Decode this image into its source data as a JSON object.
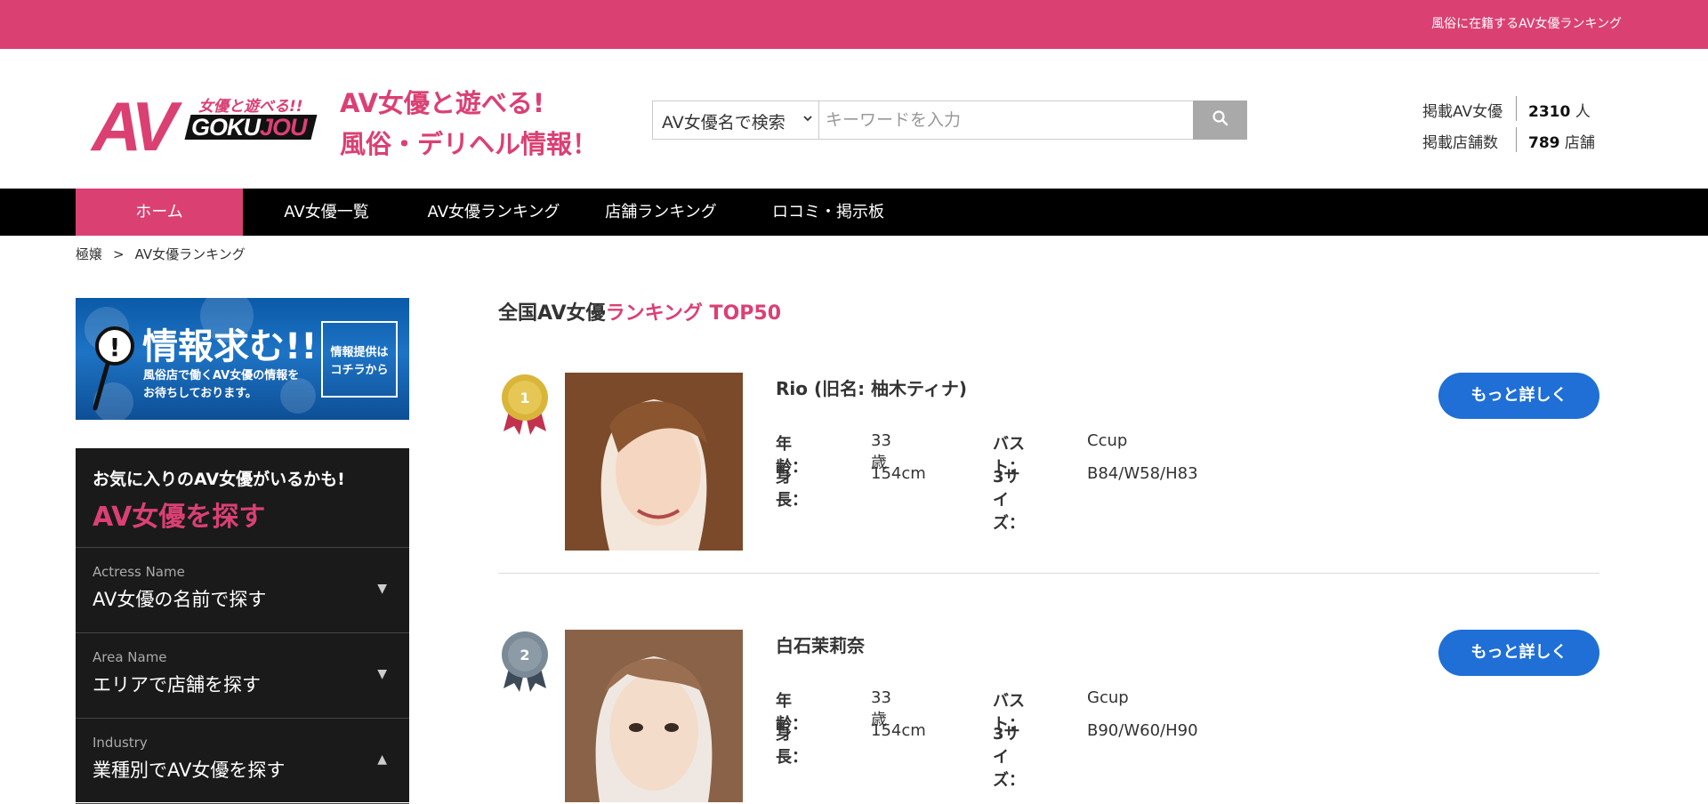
{
  "topbar": {
    "text": "風俗に在籍するAV女優ランキング"
  },
  "header": {
    "logo": {
      "av": "AV",
      "sub": "女優と遊べる!!",
      "goku": "GOKU",
      "jou": "JOU"
    },
    "tagline": [
      "AV女優と遊べる!",
      "風俗・デリヘル情報！"
    ],
    "search": {
      "select_value": "AV女優名で検索",
      "placeholder": "キーワードを入力",
      "icon": "search-icon"
    },
    "stats": [
      {
        "label": "掲載AV女優",
        "value": "2310",
        "unit": "人"
      },
      {
        "label": "掲載店舗数",
        "value": "789",
        "unit": "店舗"
      }
    ]
  },
  "nav": {
    "items": [
      "ホーム",
      "AV女優一覧",
      "AV女優ランキング",
      "店舗ランキング",
      "ロコミ・掲示板"
    ],
    "active": "ホーム"
  },
  "breadcrumb": {
    "home": "極嬢",
    "sep": ">",
    "current": "AV女優ランキング"
  },
  "sidebar": {
    "banner": {
      "big": "情報求む!!",
      "small": [
        "風俗店で働くAV女優の情報を",
        "お待ちしております。"
      ],
      "box": [
        "情報提供は",
        "コチラから"
      ]
    },
    "panel": {
      "subtitle": "お気に入りのAV女優がいるかも!",
      "title": "AV女優を探す",
      "items": [
        {
          "en": "Actress Name",
          "jp": "AV女優の名前で探す",
          "arrow": "▼"
        },
        {
          "en": "Area Name",
          "jp": "エリアで店舗を探す",
          "arrow": "▼"
        },
        {
          "en": "Industry",
          "jp": "業種別でAV女優を探す",
          "arrow": "▲"
        }
      ]
    }
  },
  "main": {
    "title_prefix": "全国AV女優",
    "title_highlight": "ランキング TOP50",
    "labels": {
      "age": "年齢：",
      "height": "身長：",
      "bust": "バスト：",
      "sizes": "3サイズ："
    },
    "detail_label": "もっと詳しく",
    "rankings": [
      {
        "rank": "1",
        "name": "Rio (旧名: 柚木ティナ)",
        "age": "33歳",
        "height": "154cm",
        "bust": "Ccup",
        "sizes": "B84/W58/H83",
        "medal_color": "#d9b53a"
      },
      {
        "rank": "2",
        "name": "白石茉莉奈",
        "age": "33歳",
        "height": "154cm",
        "bust": "Gcup",
        "sizes": "B90/W60/H90",
        "medal_color": "#7b8a97"
      }
    ]
  },
  "colors": {
    "brand": "#db4073",
    "nav_bg": "#000000",
    "button": "#1f6fd6",
    "panel_bg": "#1a1a1a"
  }
}
